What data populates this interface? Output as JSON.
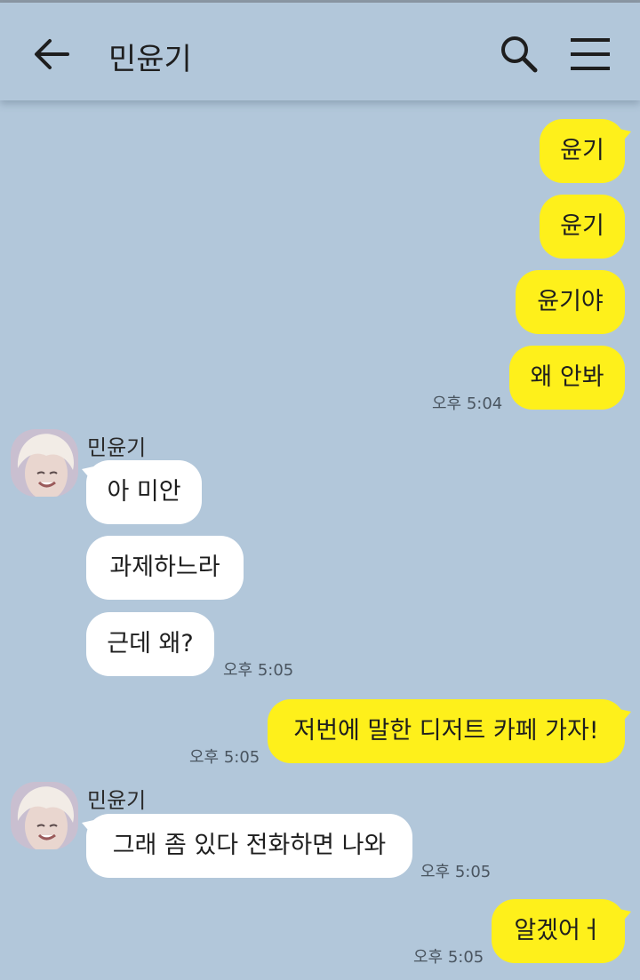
{
  "header": {
    "title": "민윤기",
    "back_icon": "arrow-left-icon",
    "search_icon": "search-icon",
    "menu_icon": "hamburger-menu-icon"
  },
  "colors": {
    "background": "#b2c7da",
    "my_bubble": "#fef01b",
    "their_bubble": "#ffffff"
  },
  "messages": [
    {
      "from": "me",
      "text": "윤기"
    },
    {
      "from": "me",
      "text": "윤기"
    },
    {
      "from": "me",
      "text": "윤기야"
    },
    {
      "from": "me",
      "text": "왜 안봐",
      "time": "오후 5:04"
    },
    {
      "from": "contact",
      "sender": "민윤기",
      "text": "아 미안"
    },
    {
      "from": "contact",
      "text": "과제하느라"
    },
    {
      "from": "contact",
      "text": "근데 왜?",
      "time": "오후 5:05"
    },
    {
      "from": "me",
      "text": "저번에 말한 디저트 카페 가자!",
      "time": "오후 5:05"
    },
    {
      "from": "contact",
      "sender": "민윤기",
      "text": "그래 좀 있다 전화하면 나와",
      "time": "오후 5:05"
    },
    {
      "from": "me",
      "text": "알겠어ㅓ",
      "time": "오후 5:05"
    }
  ]
}
